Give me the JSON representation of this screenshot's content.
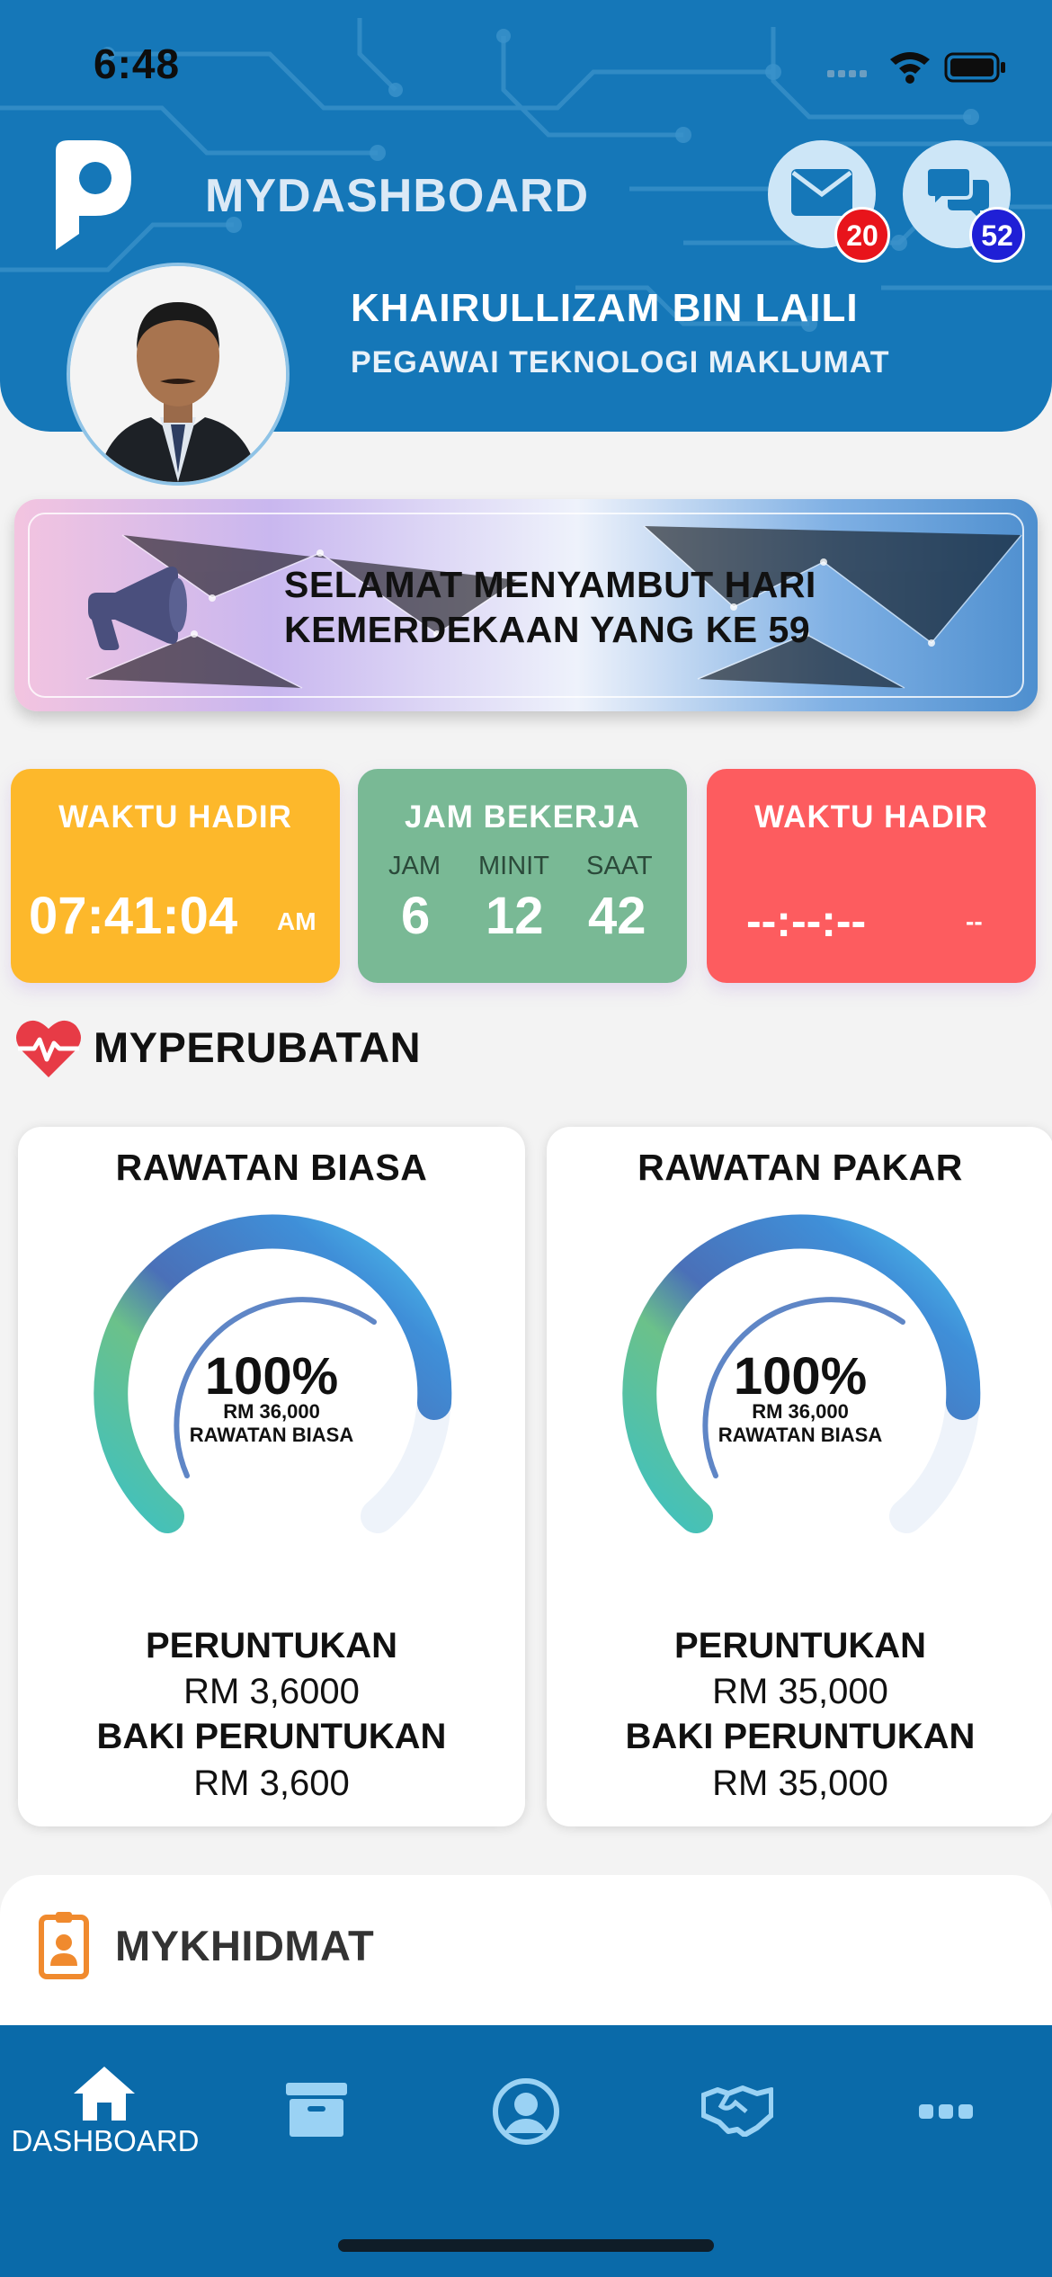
{
  "status_bar": {
    "time": "6:48"
  },
  "header": {
    "app_title": "MYDASHBOARD",
    "mail_badge": "20",
    "chat_badge": "52",
    "user_name": "KHAIRULLIZAM BIN LAILI",
    "user_role": "PEGAWAI TEKNOLOGI MAKLUMAT"
  },
  "banner": {
    "line1": "SELAMAT MENYAMBUT HARI",
    "line2": "KEMERDEKAAN YANG KE 59"
  },
  "attendance": {
    "in": {
      "title": "WAKTU HADIR",
      "time": "07:41:04",
      "period": "AM",
      "color": "#fdb82b"
    },
    "work": {
      "title": "JAM BEKERJA",
      "hours_label": "JAM",
      "minutes_label": "MINIT",
      "seconds_label": "SAAT",
      "hours": "6",
      "minutes": "12",
      "seconds": "42",
      "color": "#79b995"
    },
    "out": {
      "title": "WAKTU HADIR",
      "time": "--:--:--",
      "period": "--",
      "color": "#fd5c5f"
    }
  },
  "medical": {
    "section_title": "MYPERUBATAN",
    "cards": [
      {
        "title": "RAWATAN BIASA",
        "percent": "100%",
        "amount": "RM 36,000",
        "gauge_label": "RAWATAN BIASA",
        "allocation_label": "PERUNTUKAN",
        "allocation": "RM 3,6000",
        "balance_label": "BAKI PERUNTUKAN",
        "balance": "RM 3,600"
      },
      {
        "title": "RAWATAN PAKAR",
        "percent": "100%",
        "amount": "RM 36,000",
        "gauge_label": "RAWATAN BIASA",
        "allocation_label": "PERUNTUKAN",
        "allocation": "RM 35,000",
        "balance_label": "BAKI PERUNTUKAN",
        "balance": "RM 35,000"
      }
    ]
  },
  "service": {
    "section_title": "MYKHIDMAT"
  },
  "tab_bar": {
    "items": [
      {
        "label": "DASHBOARD",
        "icon": "home-icon",
        "active": true
      },
      {
        "icon": "archive-icon"
      },
      {
        "icon": "profile-icon"
      },
      {
        "icon": "handshake-icon"
      },
      {
        "icon": "more-icon"
      }
    ]
  },
  "colors": {
    "header": "#1577b8",
    "tabbar": "#0a6aa9",
    "mail_badge": "#e8141b",
    "chat_badge": "#1f1fd6"
  }
}
